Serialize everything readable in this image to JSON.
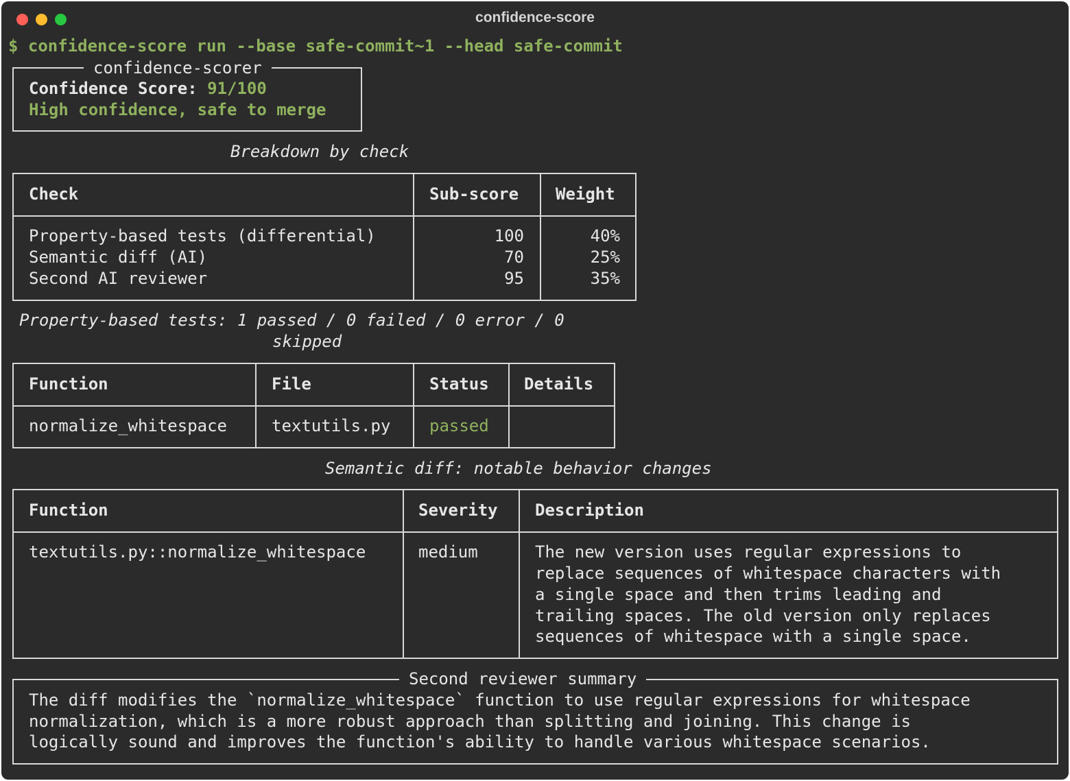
{
  "window": {
    "title": "confidence-score"
  },
  "prompt": {
    "symbol": "$",
    "command": "confidence-score run --base safe-commit~1 --head safe-commit"
  },
  "score_panel": {
    "title": "confidence-scorer",
    "score_label": "Confidence Score:",
    "score_value": "91/100",
    "verdict": "High confidence, safe to merge"
  },
  "breakdown": {
    "caption": "Breakdown by check",
    "headers": [
      "Check",
      "Sub-score",
      "Weight"
    ],
    "rows": [
      [
        "Property-based tests (differential)",
        "100",
        "40%"
      ],
      [
        "Semantic diff (AI)",
        "70",
        "25%"
      ],
      [
        "Second AI reviewer",
        "95",
        "35%"
      ]
    ]
  },
  "property_tests": {
    "caption_line1": "Property-based tests: 1 passed / 0 failed / 0 error / 0",
    "caption_line2": "skipped",
    "headers": [
      "Function",
      "File",
      "Status",
      "Details"
    ],
    "rows": [
      [
        "normalize_whitespace",
        "textutils.py",
        "passed",
        ""
      ]
    ]
  },
  "semantic_diff": {
    "caption": "Semantic diff: notable behavior changes",
    "headers": [
      "Function",
      "Severity",
      "Description"
    ],
    "rows": [
      {
        "function": "textutils.py::normalize_whitespace",
        "severity": "medium",
        "description": [
          "The new version uses regular expressions to",
          "replace sequences of whitespace characters with",
          "a single space and then trims leading and",
          "trailing spaces. The old version only replaces",
          "sequences of whitespace with a single space."
        ]
      }
    ]
  },
  "reviewer": {
    "title": "Second reviewer summary",
    "lines": [
      "The diff modifies the `normalize_whitespace` function to use regular expressions for whitespace",
      "normalization, which is a more robust approach than splitting and joining. This change is",
      "logically sound and improves the function's ability to handle various whitespace scenarios."
    ]
  },
  "colors": {
    "background": "#2b2b2b",
    "accent_green": "#8fb15e",
    "border": "#d9d9d9",
    "text": "#e6e6e6"
  }
}
